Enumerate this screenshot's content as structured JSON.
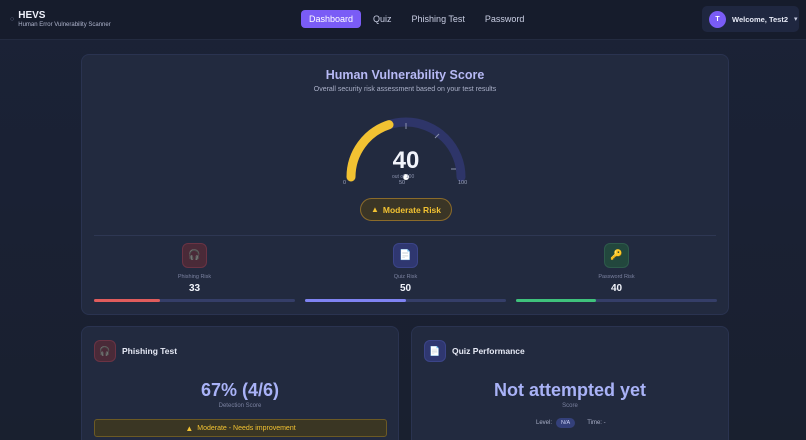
{
  "nav": {
    "brand_title": "HEVS",
    "brand_subtitle": "Human Error Vulnerability Scanner",
    "links": [
      {
        "label": "Dashboard",
        "active": true
      },
      {
        "label": "Quiz",
        "active": false
      },
      {
        "label": "Phishing Test",
        "active": false
      },
      {
        "label": "Password",
        "active": false
      }
    ],
    "user_initial": "T",
    "welcome": "Welcome, Test2",
    "caret": "▾"
  },
  "score": {
    "title": "Human Vulnerability Score",
    "subtitle": "Overall security risk assessment based on your test results",
    "value": "40",
    "out_of": "out of 100",
    "value_fraction": 0.4,
    "ticks": [
      "0",
      "50",
      "100"
    ],
    "risk_label": "Moderate Risk",
    "metrics": [
      {
        "label": "Phishing Risk",
        "value": "33",
        "fraction": 0.33,
        "icon": "headphones-icon",
        "glyph": "🎧",
        "color": "#e05c5c",
        "bg": "#4a2a38"
      },
      {
        "label": "Quiz Risk",
        "value": "50",
        "fraction": 0.5,
        "icon": "document-icon",
        "glyph": "📄",
        "color": "#7f83f2",
        "bg": "#2f3770"
      },
      {
        "label": "Password Risk",
        "value": "40",
        "fraction": 0.4,
        "icon": "key-icon",
        "glyph": "🔑",
        "color": "#3fc27c",
        "bg": "#22473d"
      }
    ]
  },
  "phishing": {
    "title": "Phishing Test",
    "icon_glyph": "🎧",
    "value": "67% (4/6)",
    "value_label": "Detection Score",
    "banner": "Moderate - Needs improvement"
  },
  "quiz": {
    "title": "Quiz Performance",
    "icon_glyph": "📄",
    "value": "Not attempted yet",
    "value_label": "Score",
    "level_label": "Level:",
    "level_value": "N/A",
    "time_label": "Time: -"
  },
  "colors": {
    "accent": "#7a5cf6",
    "gauge_fill": "#f2c232",
    "gauge_track": "#2e3569",
    "warning": "#f2c232"
  }
}
